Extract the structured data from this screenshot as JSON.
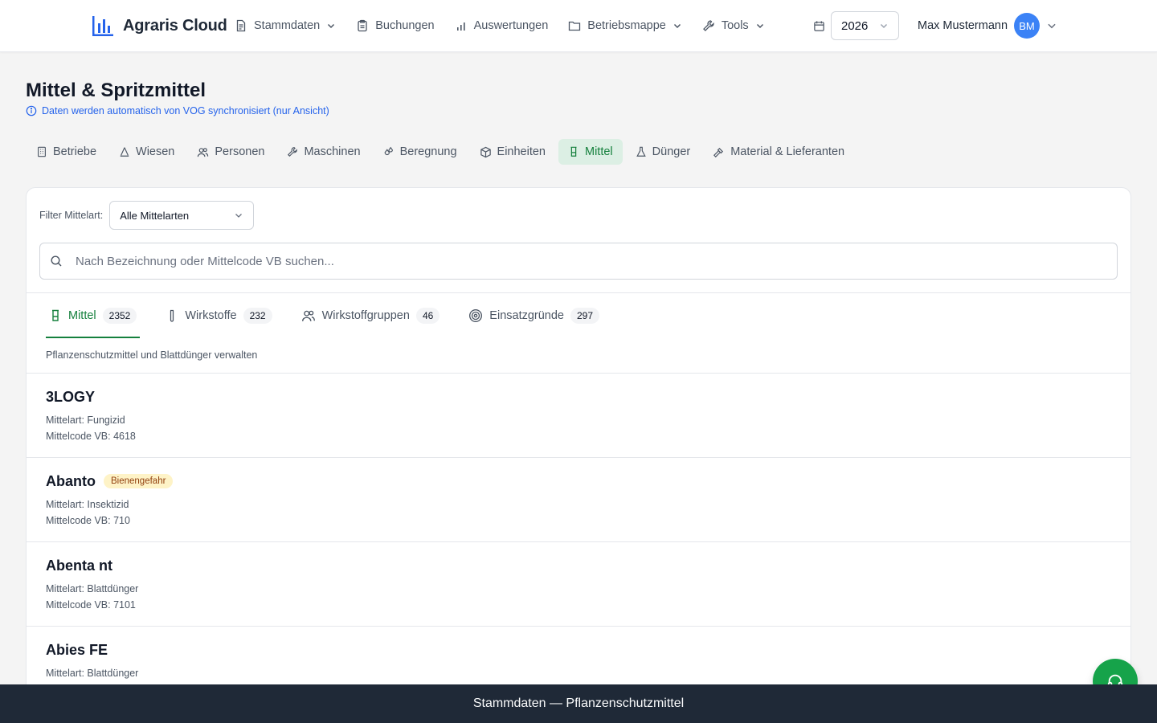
{
  "header": {
    "brand": "Agraris Cloud",
    "nav": [
      {
        "label": "Stammdaten",
        "icon": "document-icon",
        "dropdown": true
      },
      {
        "label": "Buchungen",
        "icon": "clipboard-icon",
        "dropdown": false
      },
      {
        "label": "Auswertungen",
        "icon": "bar-chart-icon",
        "dropdown": false
      },
      {
        "label": "Betriebsmappe",
        "icon": "folder-icon",
        "dropdown": true
      },
      {
        "label": "Tools",
        "icon": "wrench-icon",
        "dropdown": true
      }
    ],
    "year": "2026",
    "user_name": "Max Mustermann",
    "user_initials": "BM"
  },
  "page": {
    "title": "Mittel & Spritzmittel",
    "sync_note": "Daten werden automatisch von VOG synchronisiert (nur Ansicht)"
  },
  "category_tabs": [
    {
      "label": "Betriebe",
      "icon": "building-icon",
      "active": false
    },
    {
      "label": "Wiesen",
      "icon": "grass-icon",
      "active": false
    },
    {
      "label": "Personen",
      "icon": "users-icon",
      "active": false
    },
    {
      "label": "Maschinen",
      "icon": "wrench-icon",
      "active": false
    },
    {
      "label": "Beregnung",
      "icon": "droplets-icon",
      "active": false
    },
    {
      "label": "Einheiten",
      "icon": "package-icon",
      "active": false
    },
    {
      "label": "Mittel",
      "icon": "beaker-icon",
      "active": true
    },
    {
      "label": "Dünger",
      "icon": "flask-icon",
      "active": false
    },
    {
      "label": "Material & Lieferanten",
      "icon": "hammer-icon",
      "active": false
    }
  ],
  "filter": {
    "label": "Filter Mittelart:",
    "value": "Alle Mittelarten"
  },
  "search": {
    "placeholder": "Nach Bezeichnung oder Mittelcode VB suchen..."
  },
  "sub_tabs": [
    {
      "label": "Mittel",
      "count": "2352",
      "icon": "beaker-icon",
      "active": true
    },
    {
      "label": "Wirkstoffe",
      "count": "232",
      "icon": "test-tube-icon",
      "active": false
    },
    {
      "label": "Wirkstoffgruppen",
      "count": "46",
      "icon": "users-icon",
      "active": false
    },
    {
      "label": "Einsatzgründe",
      "count": "297",
      "icon": "target-icon",
      "active": false
    }
  ],
  "sub_tab_description": "Pflanzenschutzmittel und Blattdünger verwalten",
  "items": [
    {
      "name": "3LOGY",
      "badge": "",
      "mittelart": "Mittelart: Fungizid",
      "code": "Mittelcode VB: 4618"
    },
    {
      "name": "Abanto",
      "badge": "Bienengefahr",
      "mittelart": "Mittelart: Insektizid",
      "code": "Mittelcode VB: 710"
    },
    {
      "name": "Abenta nt",
      "badge": "",
      "mittelart": "Mittelart: Blattdünger",
      "code": "Mittelcode VB: 7101"
    },
    {
      "name": "Abies FE",
      "badge": "",
      "mittelart": "Mittelart: Blattdünger",
      "code": ""
    }
  ],
  "footer": "Stammdaten — Pflanzenschutzmittel",
  "colors": {
    "accent_green": "#15803d",
    "active_tab_bg": "#dcefe4",
    "link_blue": "#2563eb",
    "avatar_blue": "#3b82f6",
    "badge_bg": "#fef3c7",
    "footer_bg": "#1f2937",
    "fab_green": "#16a34a"
  }
}
